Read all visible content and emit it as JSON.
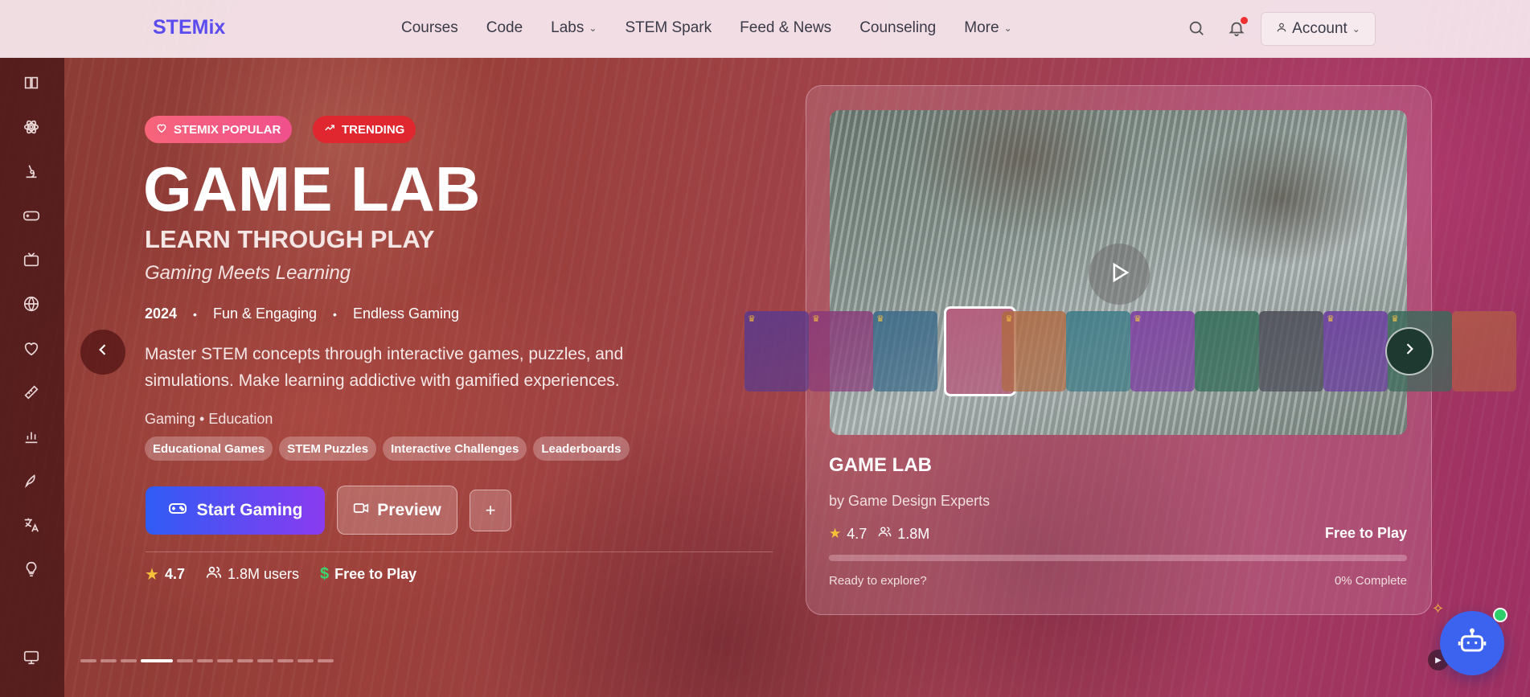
{
  "brand": "STEMix",
  "nav": {
    "links": [
      {
        "label": "Courses",
        "has_menu": false
      },
      {
        "label": "Code",
        "has_menu": false
      },
      {
        "label": "Labs",
        "has_menu": true
      },
      {
        "label": "STEM Spark",
        "has_menu": false
      },
      {
        "label": "Feed & News",
        "has_menu": false
      },
      {
        "label": "Counseling",
        "has_menu": false
      },
      {
        "label": "More",
        "has_menu": true
      }
    ],
    "account_label": "Account",
    "notification_dot": true
  },
  "sidebar": {
    "items": [
      "book-icon",
      "atom-icon",
      "microscope-icon",
      "gamepad-icon",
      "tv-icon",
      "globe-icon",
      "heart-icon",
      "ruler-icon",
      "chart-icon",
      "rocket-icon",
      "translate-icon",
      "lightbulb-icon",
      "monitor-icon"
    ]
  },
  "hero": {
    "badge_popular": "STEMIX POPULAR",
    "badge_trending": "TRENDING",
    "title": "GAME LAB",
    "subtitle": "LEARN THROUGH PLAY",
    "tagline": "Gaming Meets Learning",
    "year": "2024",
    "meta_1": "Fun & Engaging",
    "meta_2": "Endless Gaming",
    "description": "Master STEM concepts through interactive games, puzzles, and simulations. Make learning addictive with gamified experiences.",
    "categories": "Gaming • Education",
    "chips": [
      "Educational Games",
      "STEM Puzzles",
      "Interactive Challenges",
      "Leaderboards"
    ],
    "start_label": "Start Gaming",
    "preview_label": "Preview",
    "add_label": "+",
    "rating": "4.7",
    "users": "1.8M users",
    "price": "Free to Play",
    "slide_count": 12,
    "active_slide": 4
  },
  "card": {
    "title": "GAME LAB",
    "author": "by Game Design Experts",
    "rating": "4.7",
    "users": "1.8M",
    "price": "Free to Play",
    "progress": 0,
    "ready_text": "Ready to explore?",
    "complete_text": "0% Complete"
  },
  "colors": {
    "brand": "#5b4cf0",
    "start_gradient_from": "#2f5cf5",
    "start_gradient_to": "#8a3bf0",
    "trending": "#e0262e",
    "popular": "#f0508c",
    "star": "#f6c23a",
    "free": "#3cd46a",
    "bot": "#3b63f0"
  },
  "thumbnails": [
    {
      "color": "#5a3a8e",
      "crown": true
    },
    {
      "color": "#8a3a7a",
      "crown": true
    },
    {
      "color": "#3a6a8a",
      "crown": true
    },
    {
      "color": "#b4607e",
      "crown": false,
      "active": true
    },
    {
      "color": "#b06a42",
      "crown": true
    },
    {
      "color": "#3a7a86",
      "crown": false
    },
    {
      "color": "#7a3aa0",
      "crown": true
    },
    {
      "color": "#2f6a56",
      "crown": false
    },
    {
      "color": "#4a4a56",
      "crown": false
    },
    {
      "color": "#6a3aa0",
      "crown": true
    },
    {
      "color": "#3a6a5a",
      "crown": true
    },
    {
      "color": "#b05a48",
      "crown": false
    }
  ]
}
